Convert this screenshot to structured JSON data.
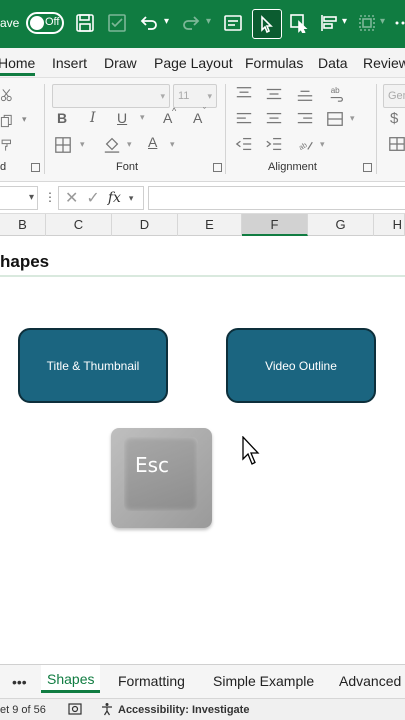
{
  "titlebar": {
    "save_label": "ave",
    "autosave_state": "Off",
    "color": "#107c41"
  },
  "ribbon_tabs": [
    "Home",
    "Insert",
    "Draw",
    "Page Layout",
    "Formulas",
    "Data",
    "Review"
  ],
  "active_tab": "Home",
  "ribbon": {
    "font_size": "11",
    "number_format": "Gen",
    "groups": {
      "clipboard": "d",
      "font": "Font",
      "alignment": "Alignment"
    },
    "bold": "B",
    "italic": "I",
    "underline": "U",
    "grow": "A",
    "shrink": "A",
    "fontcolor": "A"
  },
  "formula_bar": {
    "fx_label": "fx"
  },
  "columns": [
    "B",
    "C",
    "D",
    "E",
    "F",
    "G",
    "H"
  ],
  "selected_column": "F",
  "sheet": {
    "title": "hapes",
    "shape_1": "Title & Thumbnail",
    "shape_2": "Video Outline",
    "key_label": "Esc",
    "shape_color": "#1b6580"
  },
  "sheet_tabs": {
    "more": "•••",
    "tabs": [
      "Shapes",
      "Formatting",
      "Simple Example",
      "Advanced"
    ],
    "active": "Shapes"
  },
  "status": {
    "sheet_position": "et 9 of 56",
    "accessibility": "Accessibility: Investigate"
  }
}
